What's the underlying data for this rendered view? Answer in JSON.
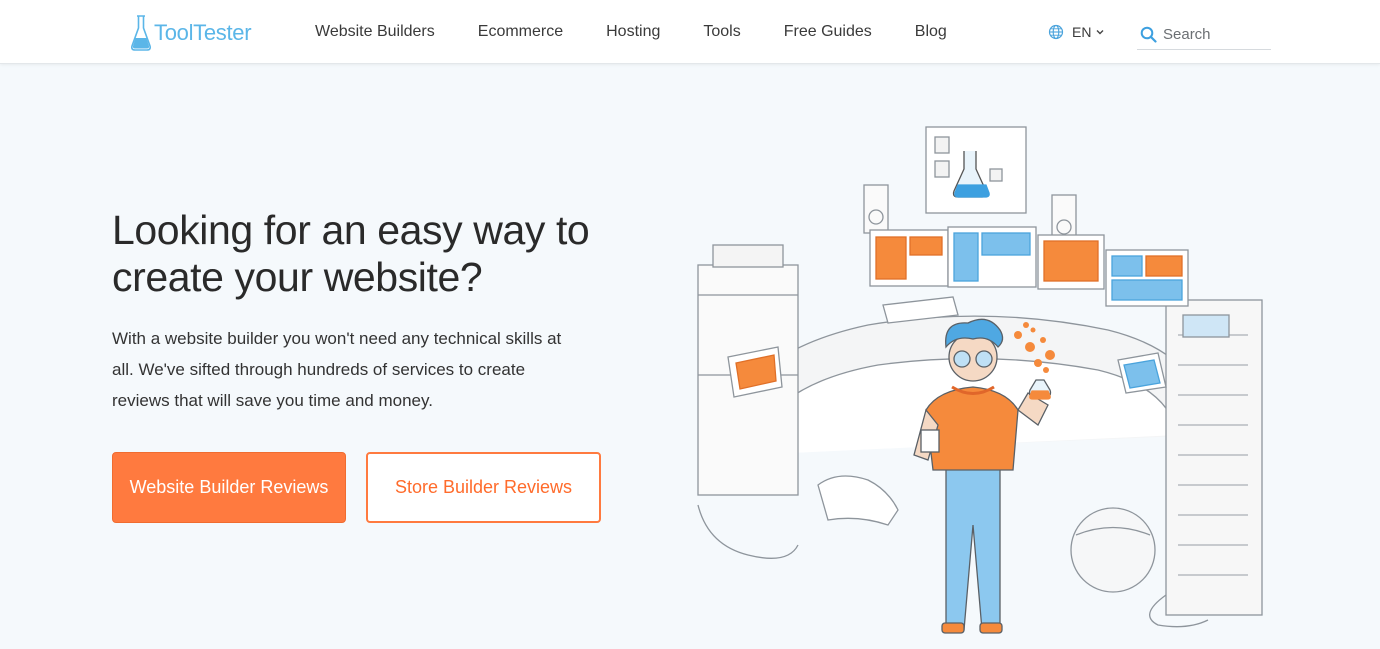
{
  "brand": {
    "name": "ToolTester",
    "accent": "#5bb6e8",
    "cta_color": "#ff7a3f"
  },
  "nav": {
    "items": [
      {
        "label": "Website Builders"
      },
      {
        "label": "Ecommerce"
      },
      {
        "label": "Hosting"
      },
      {
        "label": "Tools"
      },
      {
        "label": "Free Guides"
      },
      {
        "label": "Blog"
      }
    ]
  },
  "language": {
    "icon": "globe-icon",
    "value": "EN"
  },
  "search": {
    "icon": "search-icon",
    "placeholder": "Search"
  },
  "hero": {
    "headline": "Looking for an easy way to create your website?",
    "lead": "With a website builder you won't need any technical skills at all. We've sifted through hundreds of services to create reviews that will save you time and money.",
    "primary_button": "Website Builder Reviews",
    "secondary_button": "Store Builder Reviews",
    "illustration": "tester-workstation-illustration"
  }
}
